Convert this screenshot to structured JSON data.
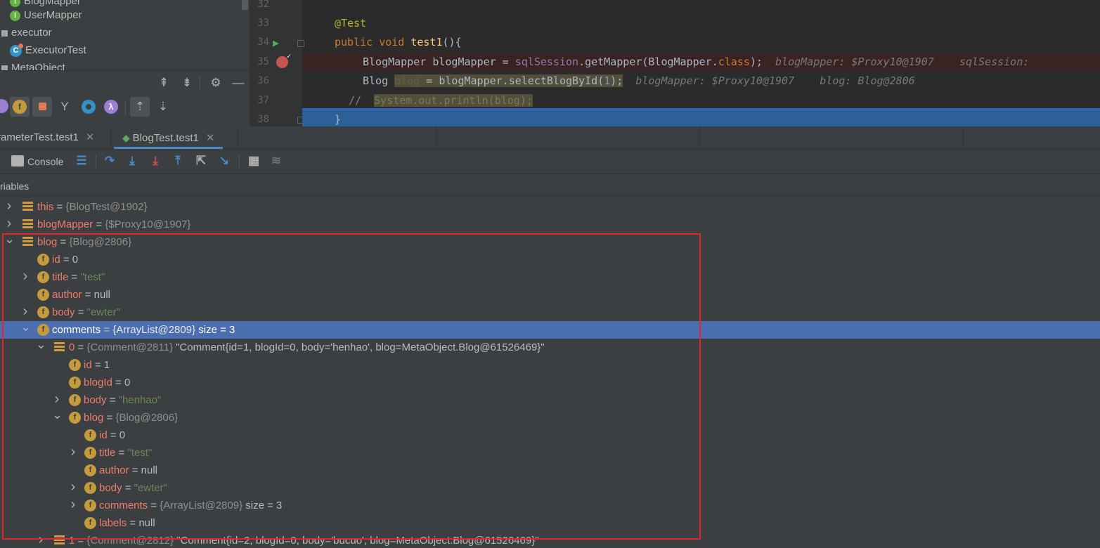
{
  "project_tree": [
    {
      "label": "BlogMapper",
      "icon": "interface-icon"
    },
    {
      "label": "UserMapper",
      "icon": "interface-icon"
    },
    {
      "label": "executor",
      "icon": "package-icon"
    },
    {
      "label": "ExecutorTest",
      "icon": "test-class-icon"
    },
    {
      "label": "MetaObject",
      "icon": "package-icon"
    }
  ],
  "editor": {
    "line_numbers": [
      "32",
      "33",
      "34",
      "35",
      "36",
      "37",
      "38"
    ],
    "line33": "@Test",
    "line34": {
      "kw": "public void ",
      "fn": "test1",
      "rest": "(){"
    },
    "line35": {
      "code_a": "BlogMapper blogMapper = ",
      "field": "sqlSession",
      "code_b": ".getMapper(BlogMapper.",
      "kw": "class",
      "code_c": ");",
      "hint": "blogMapper: $Proxy10@1907    sqlSession: "
    },
    "line36": {
      "code_a": "Blog ",
      "var": "blog",
      "code_b": " = blogMapper.selectBlogById(",
      "num": "1",
      "code_c": ");",
      "hint": "blogMapper: $Proxy10@1907    blog: Blog@2806"
    },
    "line37": {
      "comment": "//",
      "code": "System.out.println(blog);"
    },
    "line38": "}"
  },
  "debug_tabs": [
    {
      "label": "rameterTest.test1",
      "active": false
    },
    {
      "label": "BlogTest.test1",
      "active": true
    }
  ],
  "debug_toolbar": {
    "console_label": "Console"
  },
  "variables_header": "riables",
  "variables": [
    {
      "depth": 0,
      "arrow": "right",
      "icon": "list",
      "name": "this",
      "type": "{BlogTest@1902}",
      "value": "",
      "extra": ""
    },
    {
      "depth": 0,
      "arrow": "right",
      "icon": "list",
      "name": "blogMapper",
      "type": "{$Proxy10@1907}",
      "value": "",
      "extra": ""
    },
    {
      "depth": 0,
      "arrow": "down",
      "icon": "list",
      "name": "blog",
      "type": "{Blog@2806}",
      "value": "",
      "extra": ""
    },
    {
      "depth": 1,
      "arrow": "",
      "icon": "field",
      "name": "id",
      "type": "",
      "value": "0",
      "extra": ""
    },
    {
      "depth": 1,
      "arrow": "right",
      "icon": "field",
      "name": "title",
      "type": "",
      "str": "\"test\"",
      "extra": ""
    },
    {
      "depth": 1,
      "arrow": "",
      "icon": "field",
      "name": "author",
      "type": "",
      "value": "null",
      "extra": ""
    },
    {
      "depth": 1,
      "arrow": "right",
      "icon": "field",
      "name": "body",
      "type": "",
      "str": "\"ewter\"",
      "extra": ""
    },
    {
      "depth": 1,
      "arrow": "down",
      "icon": "field",
      "name": "comments",
      "type": "{ArrayList@2809}",
      "value": "",
      "extra": "size = 3",
      "selected": true
    },
    {
      "depth": 2,
      "arrow": "down",
      "icon": "list",
      "name": "0",
      "type": "{Comment@2811}",
      "value": "",
      "extra": "\"Comment{id=1, blogId=0, body='henhao', blog=MetaObject.Blog@61526469}\""
    },
    {
      "depth": 3,
      "arrow": "",
      "icon": "field",
      "name": "id",
      "type": "",
      "value": "1",
      "extra": ""
    },
    {
      "depth": 3,
      "arrow": "",
      "icon": "field",
      "name": "blogId",
      "type": "",
      "value": "0",
      "extra": ""
    },
    {
      "depth": 3,
      "arrow": "right",
      "icon": "field",
      "name": "body",
      "type": "",
      "str": "\"henhao\"",
      "extra": ""
    },
    {
      "depth": 3,
      "arrow": "down",
      "icon": "field",
      "name": "blog",
      "type": "{Blog@2806}",
      "value": "",
      "extra": ""
    },
    {
      "depth": 4,
      "arrow": "",
      "icon": "field",
      "name": "id",
      "type": "",
      "value": "0",
      "extra": ""
    },
    {
      "depth": 4,
      "arrow": "right",
      "icon": "field",
      "name": "title",
      "type": "",
      "str": "\"test\"",
      "extra": ""
    },
    {
      "depth": 4,
      "arrow": "",
      "icon": "field",
      "name": "author",
      "type": "",
      "value": "null",
      "extra": ""
    },
    {
      "depth": 4,
      "arrow": "right",
      "icon": "field",
      "name": "body",
      "type": "",
      "str": "\"ewter\"",
      "extra": ""
    },
    {
      "depth": 4,
      "arrow": "right",
      "icon": "field",
      "name": "comments",
      "type": "{ArrayList@2809}",
      "value": "",
      "extra": "size = 3"
    },
    {
      "depth": 4,
      "arrow": "",
      "icon": "field",
      "name": "labels",
      "type": "",
      "value": "null",
      "extra": ""
    },
    {
      "depth": 2,
      "arrow": "right",
      "icon": "list",
      "name": "1",
      "type": "{Comment@2812}",
      "value": "",
      "extra": "\"Comment{id=2, blogId=0, body='bucuo', blog=MetaObject.Blog@61526469}\""
    }
  ],
  "colors": {
    "selection": "#4b6eaf",
    "highlight_box": "#e0272b",
    "breakpoint": "#c75450"
  }
}
